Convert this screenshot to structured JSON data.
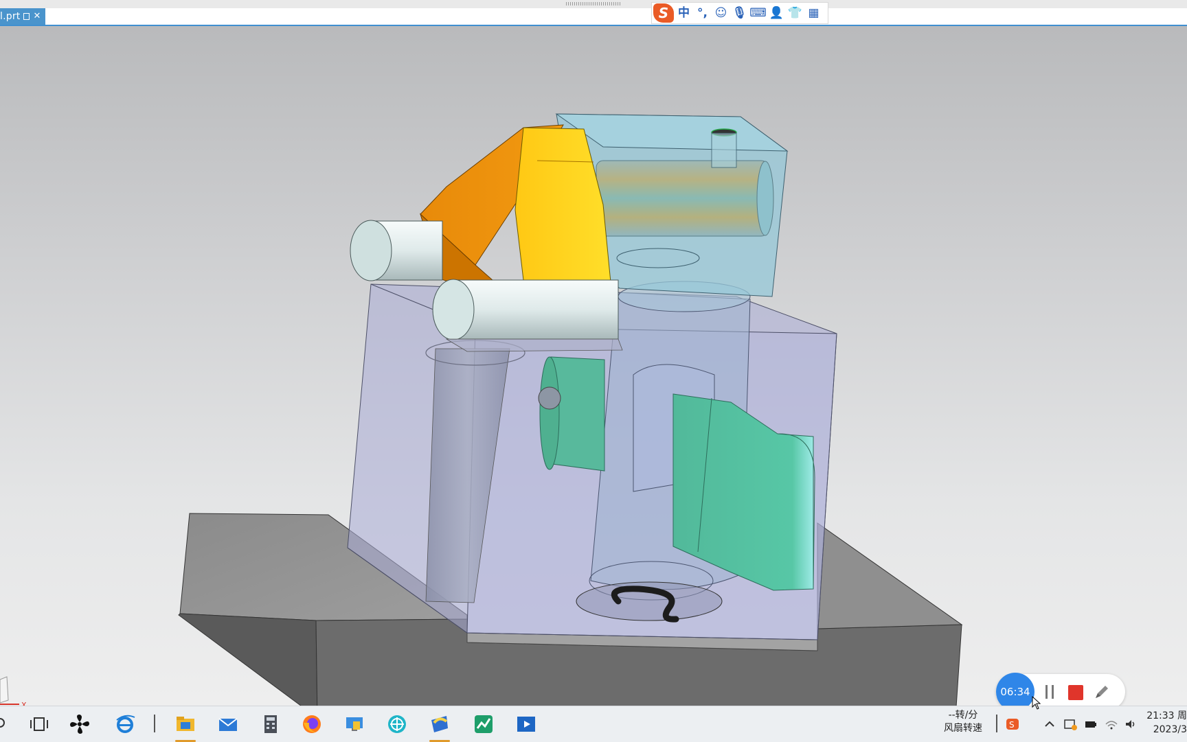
{
  "tab": {
    "title": "l.prt",
    "close_glyph": "✕"
  },
  "ime_toolbar": {
    "logo": "S",
    "items": [
      {
        "icon": "chinese-mode-icon",
        "text": "中"
      },
      {
        "icon": "punctuation-icon",
        "text": "°,"
      },
      {
        "icon": "emoji-icon",
        "text": "☺"
      },
      {
        "icon": "microphone-icon",
        "text": "🎙"
      },
      {
        "icon": "keyboard-icon",
        "text": "⌨"
      },
      {
        "icon": "user-icon",
        "text": "👤"
      },
      {
        "icon": "skin-icon",
        "text": "👕"
      },
      {
        "icon": "apps-grid-icon",
        "text": "▦"
      }
    ]
  },
  "viewport": {
    "axis_label": "X"
  },
  "recorder": {
    "time": "06:34"
  },
  "taskbar": {
    "fan_speed_value": "--转/分",
    "fan_speed_label": "风扇转速",
    "clock_time": "21:33 周",
    "clock_date": "2023/3"
  },
  "colors": {
    "accent_blue": "#4a94cc",
    "orange_part": "#e8870a",
    "yellow_part": "#ffd21f",
    "green_part": "#4fbf9f",
    "recorder_blue": "#2f86e8",
    "stop_red": "#e0352b"
  }
}
